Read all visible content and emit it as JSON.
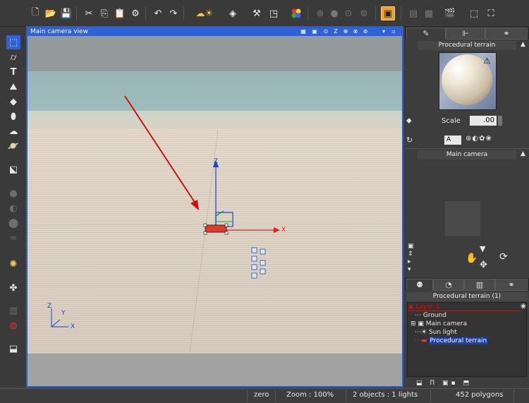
{
  "app": {
    "accent": "#2d62d8"
  },
  "toolbar": {
    "icons": [
      "new-file-icon",
      "open-file-icon",
      "save-icon",
      "cut-icon",
      "copy-icon",
      "paste-icon",
      "object-settings-icon",
      "undo-icon",
      "redo-icon",
      "atmosphere-icon",
      "render-icon",
      "render-options-icon",
      "color-palette-icon",
      "zoom-in-icon",
      "zoom-out-icon",
      "zoom-icon",
      "zoom-fit-icon",
      "active-view-icon",
      "multi-view-icon",
      "film-icon",
      "clapper-icon",
      "frame-icon",
      "fullscreen-icon"
    ]
  },
  "left_tools": {
    "icons": [
      "select-tool-icon",
      "cylinder-icon",
      "text-icon",
      "terrain-icon",
      "rock-icon",
      "plant-icon",
      "cloud-icon",
      "planet-icon",
      "import-icon",
      "boolean-icon",
      "metaball-icon",
      "group-icon",
      "link-icon",
      "light-icon",
      "wind-icon",
      "chart-icon",
      "planet-render-icon",
      "export-icon"
    ]
  },
  "viewport": {
    "title": "Main camera view",
    "axis_labels": {
      "z": "Z",
      "x": "X",
      "y": "Y"
    },
    "corner_axes": {
      "z": "Z",
      "y": "Y",
      "x": "X"
    }
  },
  "material_panel": {
    "title": "Procedural terrain",
    "scale_label": "Scale",
    "scale_value": ".00",
    "mapping_value": "A"
  },
  "camera_panel": {
    "title": "Main camera"
  },
  "scene_panel": {
    "title": "Procedural terrain (1)",
    "layer": "Layer 1",
    "items": [
      {
        "label": "Ground",
        "icon": "ground-icon"
      },
      {
        "label": "Main camera",
        "icon": "camera-icon"
      },
      {
        "label": "Sun light",
        "icon": "sun-icon"
      },
      {
        "label": "Procedural terrain",
        "icon": "terrain-icon",
        "selected": true
      }
    ]
  },
  "status": {
    "state": "zero",
    "zoom": "Zoom : 100%",
    "objects": "2 objects : 1 lights",
    "polygons": "452 polygons"
  }
}
